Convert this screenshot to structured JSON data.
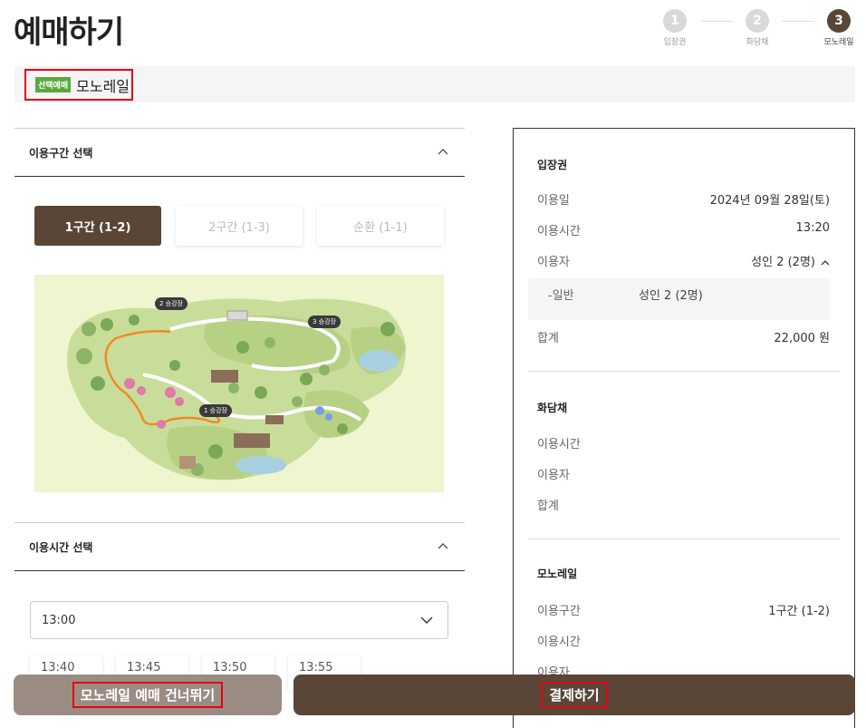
{
  "header": {
    "title": "예매하기"
  },
  "stepper": [
    {
      "number": "1",
      "label": "입장권",
      "active": false
    },
    {
      "number": "2",
      "label": "화담채",
      "active": false
    },
    {
      "number": "3",
      "label": "모노레일",
      "active": true
    }
  ],
  "selected": {
    "badge": "선택예매",
    "name": "모노레일"
  },
  "route_section": {
    "title": "이용구간 선택",
    "zones": [
      {
        "label": "1구간 (1-2)",
        "active": true
      },
      {
        "label": "2구간 (1-3)",
        "active": false
      },
      {
        "label": "순환 (1-1)",
        "active": false
      }
    ],
    "map": {
      "station_1": "1 승강장",
      "station_2": "2 승강장",
      "station_3": "3 승강장"
    }
  },
  "time_section": {
    "title": "이용시간 선택",
    "selected_time": "13:00",
    "time_options": [
      "13:40",
      "13:45",
      "13:50",
      "13:55"
    ]
  },
  "summary": {
    "admission": {
      "title": "입장권",
      "date_label": "이용일",
      "date_value": "2024년 09월 28일(토)",
      "time_label": "이용시간",
      "time_value": "13:20",
      "user_label": "이용자",
      "user_value": "성인 2 (2명)",
      "sub_label": "-일반",
      "sub_value": "성인 2 (2명)",
      "total_label": "합계",
      "total_value": "22,000 원"
    },
    "hwadamchae": {
      "title": "화담채",
      "time_label": "이용시간",
      "user_label": "이용자",
      "total_label": "합계"
    },
    "monorail": {
      "title": "모노레일",
      "route_label": "이용구간",
      "route_value": "1구간 (1-2)",
      "time_label": "이용시간",
      "user_label": "이용자"
    }
  },
  "footer": {
    "skip_label": "모노레일 예매 건너뛰기",
    "pay_label": "결제하기"
  },
  "colors": {
    "primary": "#5a4637",
    "secondary": "#9b8c83",
    "badge": "#5ba83f",
    "highlight": "#e60012"
  }
}
